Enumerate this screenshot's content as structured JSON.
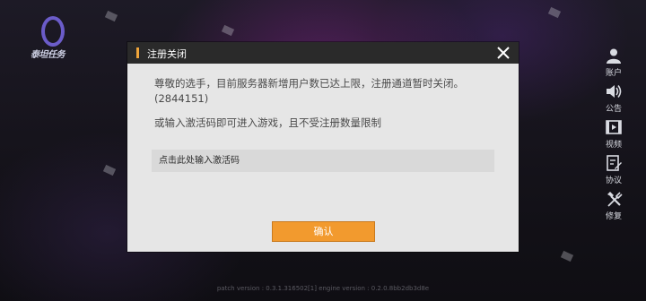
{
  "logo": {
    "text": "泰坦任务"
  },
  "side_menu": [
    {
      "label": "账户",
      "icon": "account-icon"
    },
    {
      "label": "公告",
      "icon": "announcement-icon"
    },
    {
      "label": "视频",
      "icon": "video-icon"
    },
    {
      "label": "协议",
      "icon": "agreement-icon"
    },
    {
      "label": "修复",
      "icon": "repair-icon"
    }
  ],
  "modal": {
    "title": "注册关闭",
    "message_line1": "尊敬的选手，目前服务器新增用户数已达上限，注册通道暂时关闭。",
    "message_line2": "(2844151)",
    "hint": "或输入激活码即可进入游戏，且不受注册数量限制",
    "input_placeholder": "点击此处输入激活码",
    "input_value": "",
    "confirm_label": "确认"
  },
  "footer": {
    "version": "patch version : 0.3.1.316502[1] engine version : 0.2.0.8bb2db3d8e"
  },
  "colors": {
    "accent": "#f0a53a",
    "confirm_button": "#f29a2e",
    "modal_header": "#2a2a2a",
    "modal_body": "#e6e6e6"
  }
}
